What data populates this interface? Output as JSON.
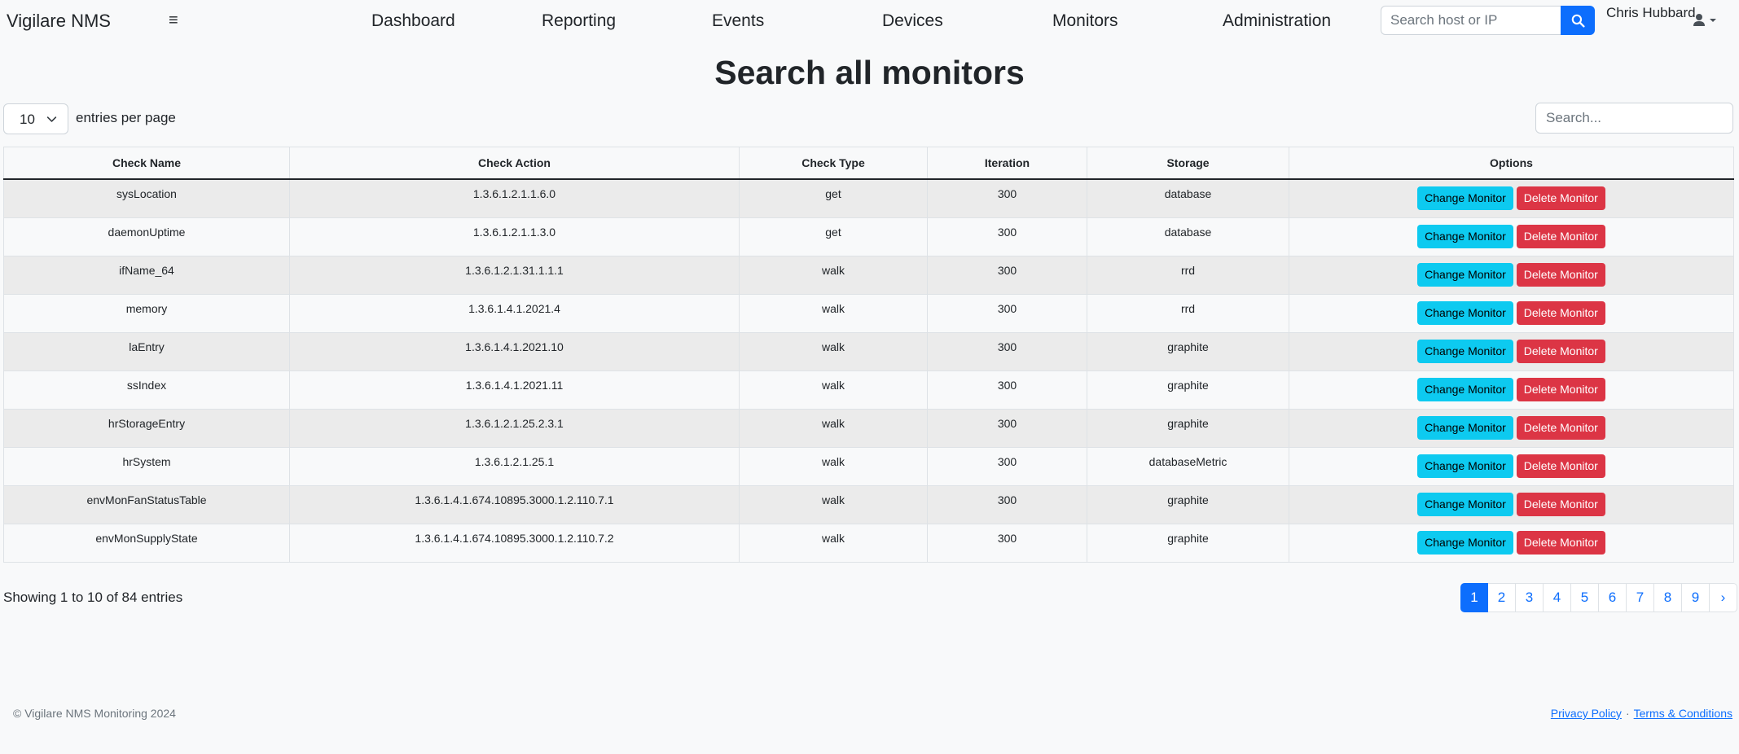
{
  "navbar": {
    "brand": "Vigilare NMS",
    "menu_icon": "hamburger-icon",
    "links": [
      "Dashboard",
      "Reporting",
      "Events",
      "Devices",
      "Monitors",
      "Administration"
    ],
    "search_placeholder": "Search host or IP",
    "search_icon": "search-icon",
    "user_name": "Chris Hubbard",
    "user_icon": "user-icon",
    "accent_color": "#0d6efd"
  },
  "page": {
    "title": "Search all monitors"
  },
  "controls": {
    "entries_per_page_value": "10",
    "entries_per_page_label": "entries per page",
    "search_placeholder": "Search..."
  },
  "table": {
    "columns": [
      "Check Name",
      "Check Action",
      "Check Type",
      "Iteration",
      "Storage",
      "Options"
    ],
    "change_label": "Change Monitor",
    "delete_label": "Delete Monitor",
    "change_color": "#0dcaf0",
    "delete_color": "#dc3545",
    "rows": [
      {
        "name": "sysLocation",
        "action": "1.3.6.1.2.1.1.6.0",
        "type": "get",
        "iteration": "300",
        "storage": "database"
      },
      {
        "name": "daemonUptime",
        "action": "1.3.6.1.2.1.1.3.0",
        "type": "get",
        "iteration": "300",
        "storage": "database"
      },
      {
        "name": "ifName_64",
        "action": "1.3.6.1.2.1.31.1.1.1",
        "type": "walk",
        "iteration": "300",
        "storage": "rrd"
      },
      {
        "name": "memory",
        "action": "1.3.6.1.4.1.2021.4",
        "type": "walk",
        "iteration": "300",
        "storage": "rrd"
      },
      {
        "name": "laEntry",
        "action": "1.3.6.1.4.1.2021.10",
        "type": "walk",
        "iteration": "300",
        "storage": "graphite"
      },
      {
        "name": "ssIndex",
        "action": "1.3.6.1.4.1.2021.11",
        "type": "walk",
        "iteration": "300",
        "storage": "graphite"
      },
      {
        "name": "hrStorageEntry",
        "action": "1.3.6.1.2.1.25.2.3.1",
        "type": "walk",
        "iteration": "300",
        "storage": "graphite"
      },
      {
        "name": "hrSystem",
        "action": "1.3.6.1.2.1.25.1",
        "type": "walk",
        "iteration": "300",
        "storage": "databaseMetric"
      },
      {
        "name": "envMonFanStatusTable",
        "action": "1.3.6.1.4.1.674.10895.3000.1.2.110.7.1",
        "type": "walk",
        "iteration": "300",
        "storage": "graphite"
      },
      {
        "name": "envMonSupplyState",
        "action": "1.3.6.1.4.1.674.10895.3000.1.2.110.7.2",
        "type": "walk",
        "iteration": "300",
        "storage": "graphite"
      }
    ]
  },
  "info": "Showing 1 to 10 of 84 entries",
  "pagination": {
    "pages": [
      "1",
      "2",
      "3",
      "4",
      "5",
      "6",
      "7",
      "8",
      "9"
    ],
    "active": "1",
    "next": "›"
  },
  "footer": {
    "copyright": "© Vigilare NMS Monitoring 2024",
    "privacy": "Privacy Policy",
    "separator": "·",
    "terms": "Terms & Conditions"
  }
}
